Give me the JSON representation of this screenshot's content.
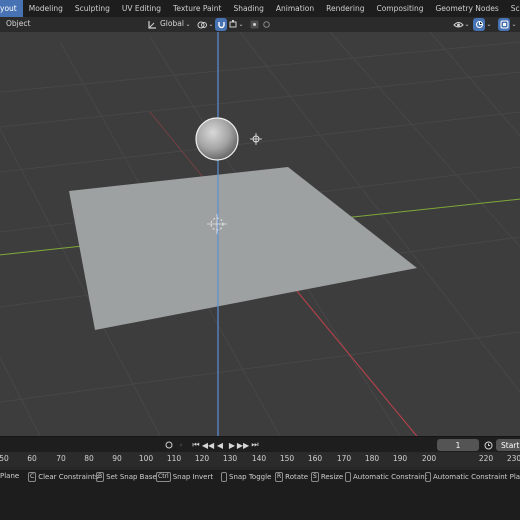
{
  "workspace_tabs": [
    "yout",
    "Modeling",
    "Sculpting",
    "UV Editing",
    "Texture Paint",
    "Shading",
    "Animation",
    "Rendering",
    "Compositing",
    "Geometry Nodes",
    "Scripting"
  ],
  "header": {
    "mode_label": "Object",
    "orientation_label": "Global"
  },
  "timeline": {
    "current_frame": "1",
    "start_label": "Start"
  },
  "ruler_ticks": [
    "50",
    "60",
    "70",
    "80",
    "90",
    "100",
    "110",
    "120",
    "130",
    "140",
    "150",
    "160",
    "170",
    "180",
    "190",
    "200",
    "220",
    "230"
  ],
  "status_bar": [
    {
      "key": "",
      "label": "Plane"
    },
    {
      "key": "C",
      "label": "Clear Constraints"
    },
    {
      "key": "B",
      "label": "Set Snap Base"
    },
    {
      "key": "Ctrl",
      "label": "Snap Invert"
    },
    {
      "key": "",
      "label": "Snap Toggle"
    },
    {
      "key": "R",
      "label": "Rotate"
    },
    {
      "key": "S",
      "label": "Resize"
    },
    {
      "key": "",
      "label": "Automatic Constraint"
    },
    {
      "key": "",
      "label": "Automatic Constraint Pla"
    }
  ],
  "colors": {
    "active_tab": "#4772b3",
    "viewport_bg": "#3d3d3d",
    "plane": "#9da1a1",
    "z_axis": "#5b8ed6",
    "x_axis": "#c2424c",
    "y_axis": "#7ea83a"
  }
}
